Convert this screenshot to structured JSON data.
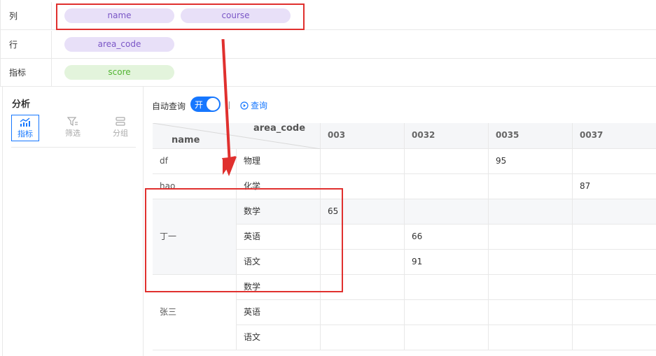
{
  "fields": {
    "columns": {
      "label": "列",
      "chips": [
        "name",
        "course"
      ]
    },
    "rows": {
      "label": "行",
      "chips": [
        "area_code"
      ]
    },
    "metrics": {
      "label": "指标",
      "chips": [
        "score"
      ]
    }
  },
  "panel": {
    "title": "分析",
    "tabs": [
      {
        "label": "指标",
        "icon": "metrics-chart-icon",
        "active": true
      },
      {
        "label": "筛选",
        "icon": "filter-icon",
        "active": false
      },
      {
        "label": "分组",
        "icon": "group-icon",
        "active": false
      }
    ]
  },
  "toolbar": {
    "auto_query_label": "自动查询",
    "toggle_text": "开",
    "query_label": "查询"
  },
  "table": {
    "corner_top": "area_code",
    "corner_bottom": "name",
    "columns": [
      "003",
      "0032",
      "0035",
      "0037"
    ],
    "rows": [
      {
        "name": "df",
        "course": "物理",
        "values": [
          "",
          "",
          "95",
          ""
        ]
      },
      {
        "name": "hao",
        "course": "化学",
        "values": [
          "",
          "",
          "",
          "87"
        ]
      },
      {
        "name": "",
        "course": "数学",
        "values": [
          "65",
          "",
          "",
          ""
        ]
      },
      {
        "name": "丁一",
        "course": "英语",
        "values": [
          "",
          "66",
          "",
          ""
        ]
      },
      {
        "name": "",
        "course": "语文",
        "values": [
          "",
          "91",
          "",
          ""
        ]
      },
      {
        "name": "",
        "course": "数学",
        "values": [
          "",
          "",
          "",
          ""
        ]
      },
      {
        "name": "张三",
        "course": "英语",
        "values": [
          "",
          "",
          "",
          ""
        ]
      },
      {
        "name": "",
        "course": "语文",
        "values": [
          "",
          "",
          "",
          ""
        ]
      }
    ]
  },
  "colors": {
    "accent": "#1677ff",
    "annotation": "#e0302e",
    "chip_purple_bg": "#e8e0f8",
    "chip_green_bg": "#e3f4dc"
  }
}
